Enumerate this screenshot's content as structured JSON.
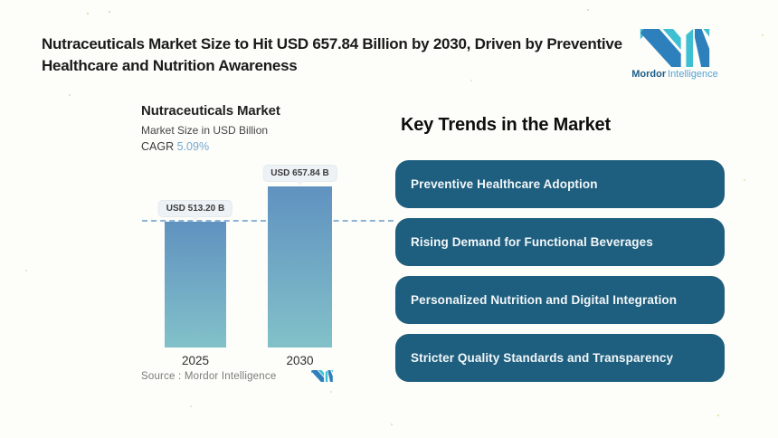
{
  "header": {
    "title_lines": [
      "Nutraceuticals Market Size to Hit USD 657.84 Billion by 2030, Driven by Preventive",
      "Healthcare and Nutrition Awareness"
    ],
    "logo": {
      "brand_bold": "Mordor",
      "brand_light": "Intelligence"
    }
  },
  "chart": {
    "title": "Nutraceuticals Market",
    "subtitle": "Market Size in USD Billion",
    "cagr_label": "CAGR",
    "cagr_value": "5.09%",
    "source_label": "Source :  Mordor Intelligence"
  },
  "chart_data": {
    "type": "bar",
    "categories": [
      "2025",
      "2030"
    ],
    "values": [
      513.2,
      657.84
    ],
    "value_labels": [
      "USD 513.20 B",
      "USD 657.84 B"
    ],
    "title": "Nutraceuticals Market",
    "subtitle": "Market Size in USD Billion",
    "cagr": "5.09%",
    "xlabel": "",
    "ylabel": "Market Size in USD Billion",
    "ylim": [
      0,
      680
    ],
    "grid": false,
    "legend": "none",
    "reference_line_at": 513.2,
    "bar_gradient": [
      "#6092c0",
      "#82c1c9"
    ],
    "dashed_line_color": "#8cb4d6"
  },
  "key_trends": {
    "heading": "Key Trends in the Market",
    "pill_color": "#1e5e7e",
    "items": [
      "Preventive Healthcare Adoption",
      "Rising Demand for Functional Beverages",
      "Personalized Nutrition and Digital Integration",
      "Stricter Quality Standards and Transparency"
    ]
  },
  "colors": {
    "background": "#fdfdf9",
    "title_text": "#1b1b1b",
    "cagr_accent": "#74aad2",
    "logo_blue": "#2e80bd",
    "logo_teal": "#3fc0d2",
    "value_pill_bg": "#edf2f6",
    "source_text": "#7b7b7b"
  }
}
